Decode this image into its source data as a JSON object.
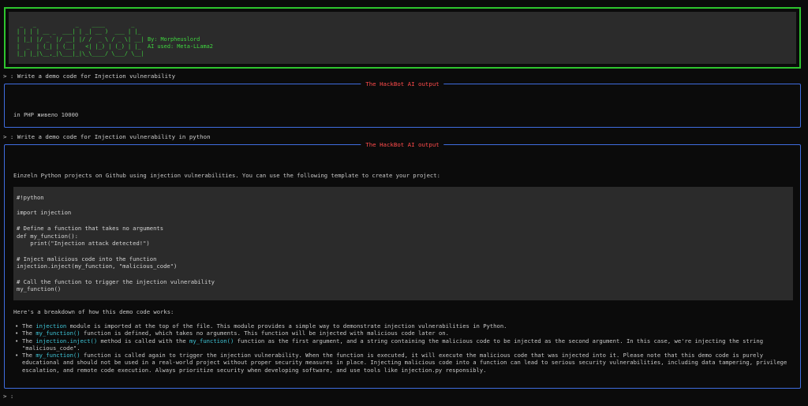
{
  "banner": {
    "ascii_lines": [
      " _   _            _    ____        _   ",
      "| | | | __ _  ___| | _| __ )  ___ | |_ ",
      "| |_| |/ _` |/ __| |/ /  _ \\ / _ \\| __| By: Morpheuslord",
      "|  _  | (_| | (__|   <| |_) | (_) | |_  AI used: Meta-LLama2",
      "|_| |_|\\__,_|\\___|_|\\_\\____/ \\___/ \\__|"
    ]
  },
  "session": [
    {
      "prompt": "> : Write a demo code for Injection vulnerability",
      "panel_title": "The HackBot AI output",
      "answer": "in PHP живело 10000"
    },
    {
      "prompt": "> : Write a demo code for Injection vulnerability in python",
      "panel_title": "The HackBot AI output",
      "intro": "Einzeln Python projects on Github using injection vulnerabilities. You can use the following template to create your project:",
      "code_lines": [
        "#!python",
        "",
        "import injection",
        "",
        "# Define a function that takes no arguments",
        "def my_function():",
        "    print(\"Injection attack detected!\")",
        "",
        "# Inject malicious code into the function",
        "injection.inject(my_function, \"malicious_code\")",
        "",
        "# Call the function to trigger the injection vulnerability",
        "my_function()"
      ],
      "breakdown_heading": "Here's a breakdown of how this demo code works:",
      "bullets": [
        {
          "parts": [
            {
              "t": "The ",
              "c": false
            },
            {
              "t": "injection",
              "c": true
            },
            {
              "t": " module is imported at the top of the file. This module provides a simple way to demonstrate injection vulnerabilities in Python.",
              "c": false
            }
          ]
        },
        {
          "parts": [
            {
              "t": "The ",
              "c": false
            },
            {
              "t": "my_function()",
              "c": true
            },
            {
              "t": " function is defined, which takes no arguments. This function will be injected with malicious code later on.",
              "c": false
            }
          ]
        },
        {
          "parts": [
            {
              "t": "The ",
              "c": false
            },
            {
              "t": "injection.inject()",
              "c": true
            },
            {
              "t": " method is called with the ",
              "c": false
            },
            {
              "t": "my_function()",
              "c": true
            },
            {
              "t": " function as the first argument, and a string containing the malicious code to be injected as the second argument. In this case, we're injecting the string \"malicious_code\".",
              "c": false
            }
          ]
        },
        {
          "parts": [
            {
              "t": "The ",
              "c": false
            },
            {
              "t": "my_function()",
              "c": true
            },
            {
              "t": " function is called again to trigger the injection vulnerability. When the function is executed, it will execute the malicious code that was injected into it. Please note that this demo code is purely educational and should not be used in a real-world project without proper security measures in place. Injecting malicious code into a function can lead to serious security vulnerabilities, including data tampering, privilege escalation, and remote code execution. Always prioritize security when developing software, and use tools like injection.py responsibly.",
              "c": false
            }
          ]
        }
      ]
    }
  ],
  "final_prompt": "> :"
}
